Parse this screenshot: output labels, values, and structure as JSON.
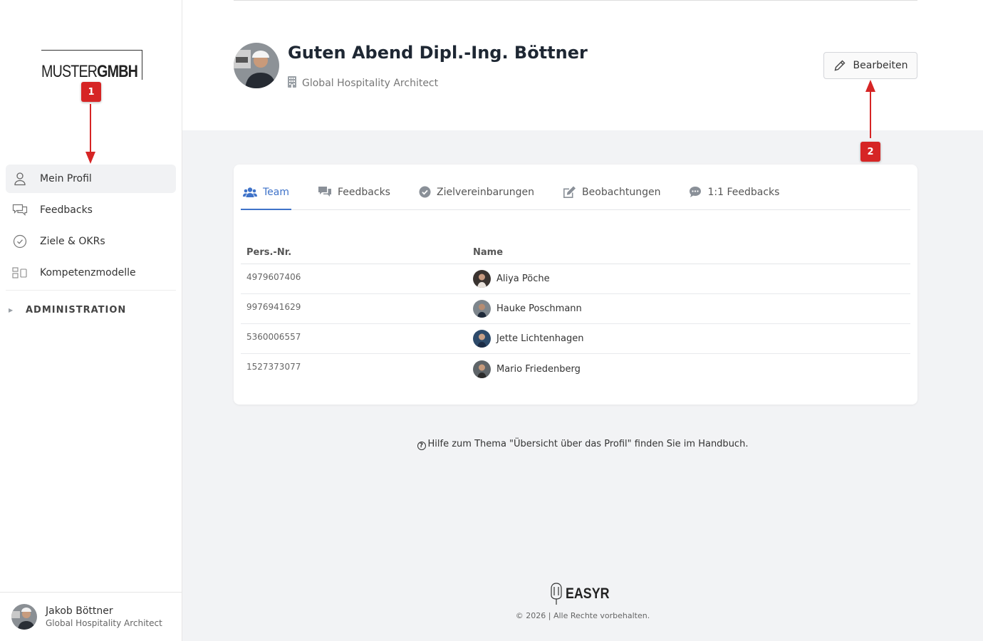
{
  "sidebar": {
    "logo": {
      "part1": "MUSTER",
      "part2": "GMBH"
    },
    "items": [
      {
        "label": "Mein Profil",
        "icon": "person-icon",
        "active": true
      },
      {
        "label": "Feedbacks",
        "icon": "chat-bubbles-icon",
        "active": false
      },
      {
        "label": "Ziele & OKRs",
        "icon": "check-circle-icon",
        "active": false
      },
      {
        "label": "Kompetenzmodelle",
        "icon": "grid-icon",
        "active": false
      }
    ],
    "admin_label": "ADMINISTRATION",
    "user": {
      "name": "Jakob Böttner",
      "role": "Global Hospitality Architect"
    }
  },
  "header": {
    "greeting": "Guten Abend Dipl.-Ing. Böttner",
    "role": "Global Hospitality Architect",
    "edit_label": "Bearbeiten"
  },
  "tabs": [
    {
      "label": "Team",
      "icon": "users-icon",
      "active": true
    },
    {
      "label": "Feedbacks",
      "icon": "comments-icon",
      "active": false
    },
    {
      "label": "Zielvereinbarungen",
      "icon": "check-circle-icon",
      "active": false
    },
    {
      "label": "Beobachtungen",
      "icon": "edit-icon",
      "active": false
    },
    {
      "label": "1:1 Feedbacks",
      "icon": "comment-dots-icon",
      "active": false
    }
  ],
  "table": {
    "headers": [
      "Pers.-Nr.",
      "Name"
    ],
    "rows": [
      {
        "id": "4979607406",
        "name": "Aliya Pöche"
      },
      {
        "id": "9976941629",
        "name": "Hauke Poschmann"
      },
      {
        "id": "5360006557",
        "name": "Jette Lichtenhagen"
      },
      {
        "id": "1527373077",
        "name": "Mario Friedenberg"
      }
    ]
  },
  "help_text": "Hilfe zum Thema \"Übersicht über das Profil\" finden Sie im Handbuch.",
  "footer": {
    "brand": "EASYR",
    "copyright": "© 2026 | Alle Rechte vorbehalten."
  },
  "annotations": [
    {
      "label": "1"
    },
    {
      "label": "2"
    }
  ],
  "colors": {
    "accent": "#3f73c9",
    "annotation": "#d62525"
  }
}
